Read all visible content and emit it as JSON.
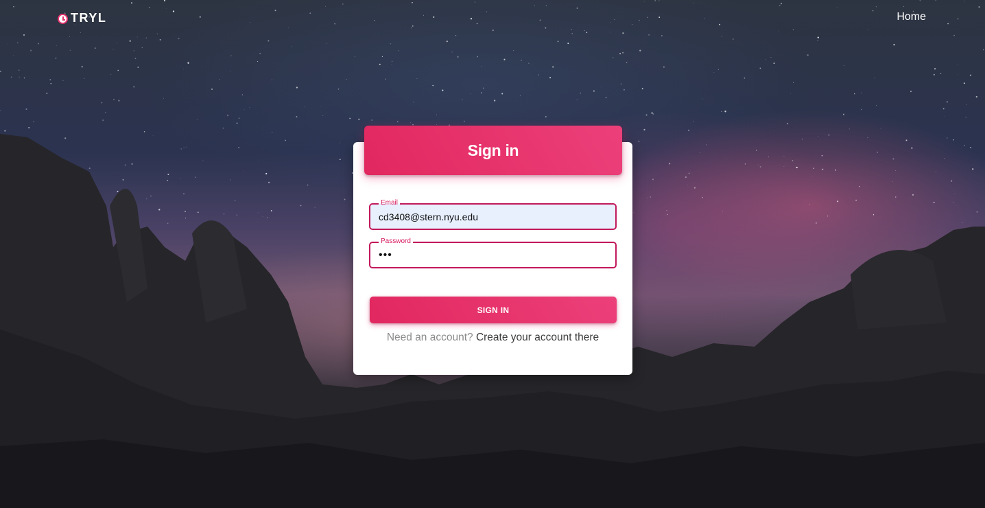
{
  "nav": {
    "brand_icon": "clock-icon",
    "brand": "TRYL",
    "home_link": "Home"
  },
  "signin": {
    "title": "Sign in",
    "email": {
      "label": "Email",
      "value": "cd3408@stern.nyu.edu"
    },
    "password": {
      "label": "Password",
      "value": "•••"
    },
    "button_label": "SIGN IN",
    "prompt_text": "Need an account?",
    "create_link": "Create your account there"
  },
  "colors": {
    "accent": "#e91e63",
    "autofill_bg": "#e8f0fe",
    "text_muted": "#8a8a8a"
  }
}
